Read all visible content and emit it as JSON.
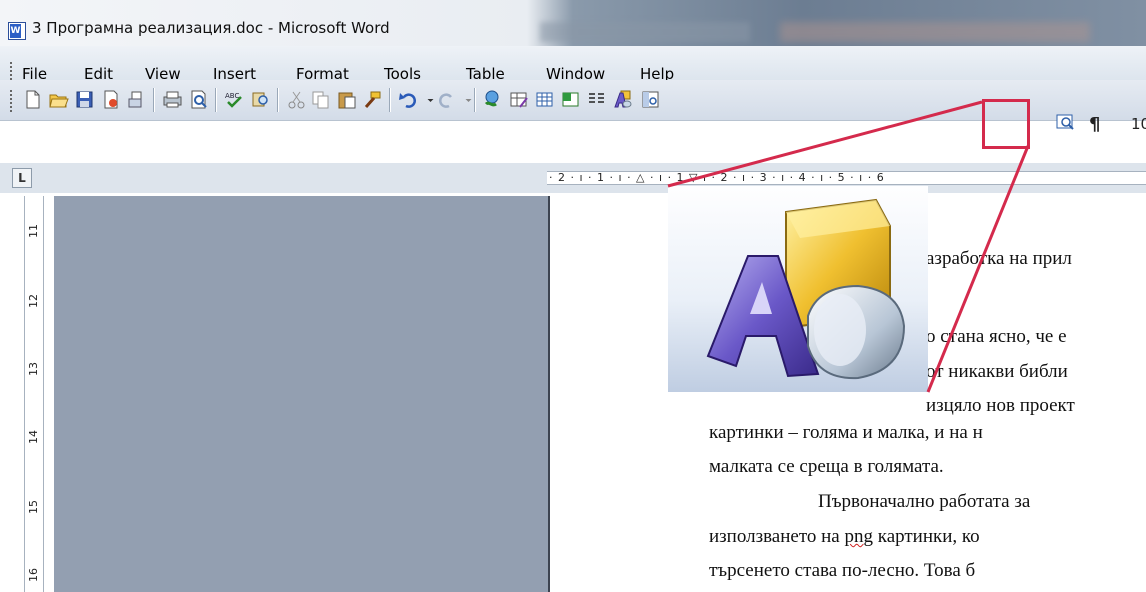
{
  "window": {
    "title": "3 Програмна реализация.doc - Microsoft Word",
    "app_icon": "word-doc-icon"
  },
  "menu": [
    "File",
    "Edit",
    "View",
    "Insert",
    "Format",
    "Tools",
    "Table",
    "Window",
    "Help"
  ],
  "toolbar": {
    "buttons": [
      "new-doc",
      "open",
      "save",
      "permission",
      "email",
      "print",
      "print-preview",
      "spelling",
      "research",
      "cut",
      "copy",
      "paste",
      "format-painter",
      "undo",
      "redo",
      "hyperlink",
      "tables-borders",
      "insert-table",
      "insert-excel",
      "columns",
      "wordart-icon",
      "document-map",
      "show-hide"
    ],
    "paragraph_mark": "¶",
    "font_size": "10"
  },
  "ruler": {
    "horizontal": "· 2 · ı · 1 · ı · △ · ı · 1 ▽ ı · 2 · ı · 3 · ı · 4 · ı · 5 · ı · 6",
    "vertical": [
      "11",
      "12",
      "13",
      "14",
      "15",
      "16"
    ],
    "corner": "L"
  },
  "document": {
    "lines": [
      "азработка на прил",
      "о стана ясно, че е",
      "от никакви библи",
      "изцяло нов проект",
      "картинки – голяма и малка, и на н",
      "малката се среща в голямата.",
      "Първоначално работата за",
      "използването на png картинки, ко",
      "търсенето става по-лесно. Това б"
    ],
    "misspelled_word": "png"
  },
  "callout": {
    "icon": "wordart-icon",
    "highlight_color": "#d42a4c"
  }
}
